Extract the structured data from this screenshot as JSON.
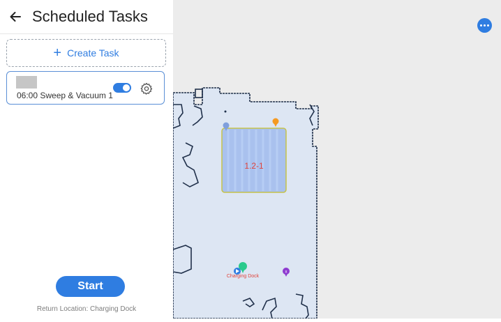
{
  "header": {
    "title": "Scheduled Tasks"
  },
  "create_task": {
    "label": "Create Task"
  },
  "tasks": [
    {
      "label": "06:00 Sweep & Vacuum 1",
      "enabled": true
    }
  ],
  "start": {
    "label": "Start"
  },
  "return_location": {
    "text": "Return Location: Charging Dock"
  },
  "map": {
    "zone_label": "1.2-1",
    "dock_label": "Charging Dock"
  },
  "colors": {
    "accent": "#2f7de1",
    "map_floor": "#dde6f3",
    "map_wall": "#20304a",
    "zone_fill": "#a9c1ee",
    "zone_label": "#e0443c"
  },
  "icons": {
    "back": "arrow-left-icon",
    "plus": "plus-icon",
    "settings": "gear-icon",
    "more": "more-horizontal-icon"
  }
}
